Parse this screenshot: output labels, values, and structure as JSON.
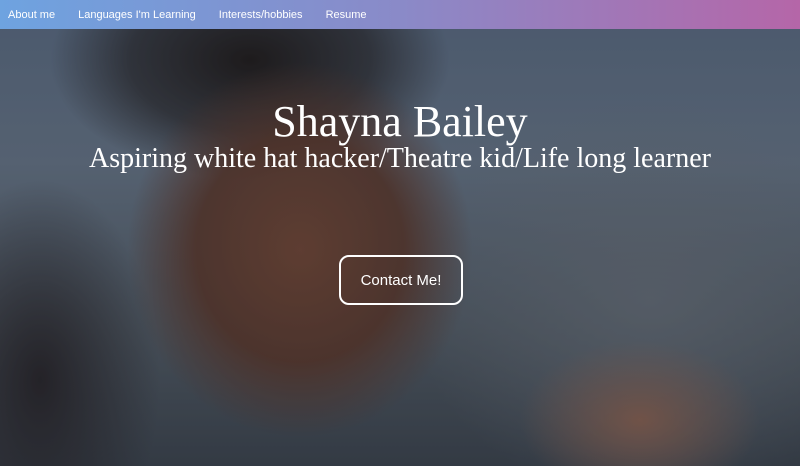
{
  "nav": {
    "items": [
      {
        "label": "About me"
      },
      {
        "label": "Languages I'm Learning"
      },
      {
        "label": "Interests/hobbies"
      },
      {
        "label": "Resume"
      }
    ]
  },
  "hero": {
    "name": "Shayna Bailey",
    "tagline": "Aspiring white hat hacker/Theatre kid/Life long learner",
    "contact_label": "Contact Me!"
  },
  "colors": {
    "navbar_gradient_start": "#6ea3e0",
    "navbar_gradient_end": "#b566a8",
    "text": "#ffffff"
  }
}
